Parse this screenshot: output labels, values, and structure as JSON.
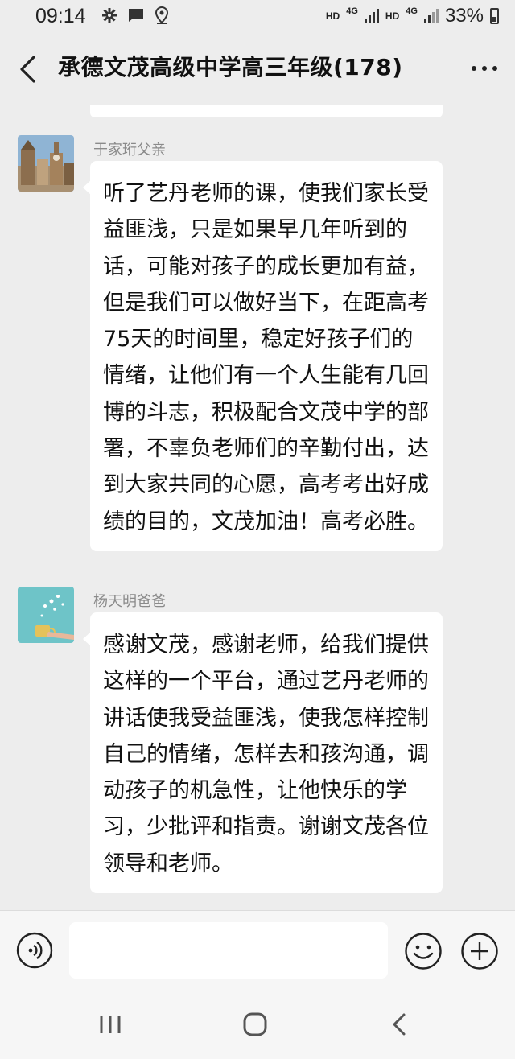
{
  "status_bar": {
    "time": "09:14",
    "left_icons": [
      "gear-icon",
      "message-icon",
      "location-icon"
    ],
    "sim1_label": "HD",
    "sim1_network": "4G",
    "sim2_label": "HD",
    "sim2_network": "4G",
    "battery": "33%"
  },
  "header": {
    "title": "承德文茂高级中学高三年级(178)"
  },
  "messages": [
    {
      "sender": "于家珩父亲",
      "text": "听了艺丹老师的课，使我们家长受益匪浅，只是如果早几年听到的话，可能对孩子的成长更加有益，但是我们可以做好当下，在距高考75天的时间里，稳定好孩子们的情绪，让他们有一个人生能有几回博的斗志，积极配合文茂中学的部署，不辜负老师们的辛勤付出，达到大家共同的心愿，高考考出好成绩的目的，文茂加油！高考必胜。"
    },
    {
      "sender": "杨天明爸爸",
      "text": "感谢文茂，感谢老师，给我们提供这样的一个平台，通过艺丹老师的讲话使我受益匪浅，使我怎样控制自己的情绪，怎样去和孩沟通，调动孩子的机急性，让他快乐的学习，少批评和指责。谢谢文茂各位领导和老师。"
    }
  ],
  "input": {
    "value": "",
    "placeholder": ""
  },
  "colors": {
    "background": "#ededed",
    "bubble": "#ffffff",
    "sender": "#8a8a8a"
  }
}
